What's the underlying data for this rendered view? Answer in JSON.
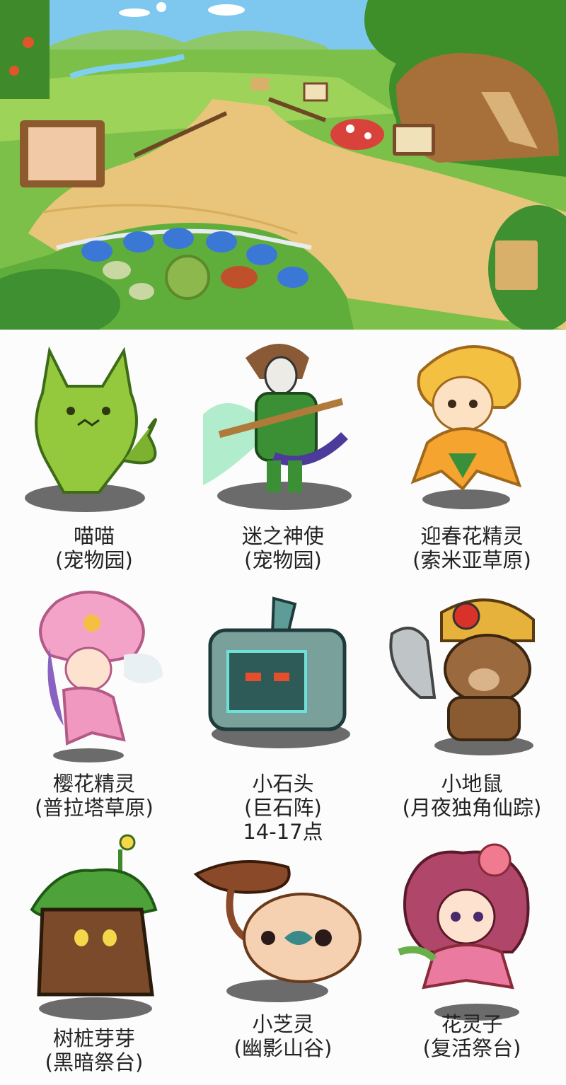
{
  "pets": [
    {
      "name": "喵喵",
      "location": "(宠物园)",
      "note": "",
      "icon": "green-cat-pet-icon"
    },
    {
      "name": "迷之神使",
      "location": "(宠物园)",
      "note": "",
      "icon": "masked-warrior-pet-icon"
    },
    {
      "name": "迎春花精灵",
      "location": "(索米亚草原)",
      "note": "",
      "icon": "yellow-flower-fairy-icon"
    },
    {
      "name": "樱花精灵",
      "location": "(普拉塔草原)",
      "note": "",
      "icon": "cherry-blossom-fairy-icon"
    },
    {
      "name": "小石头",
      "location": "(巨石阵)",
      "note": "14-17点",
      "icon": "stone-block-pet-icon"
    },
    {
      "name": "小地鼠",
      "location": "(月夜独角仙踪)",
      "note": "",
      "icon": "mole-miner-pet-icon"
    },
    {
      "name": "树桩芽芽",
      "location": "(黑暗祭台)",
      "note": "",
      "icon": "tree-stump-pet-icon"
    },
    {
      "name": "小芝灵",
      "location": "(幽影山谷)",
      "note": "",
      "icon": "mushroom-pet-icon"
    },
    {
      "name": "花灵子",
      "location": "(复活祭台)",
      "note": "",
      "icon": "rose-flower-fairy-icon"
    }
  ]
}
